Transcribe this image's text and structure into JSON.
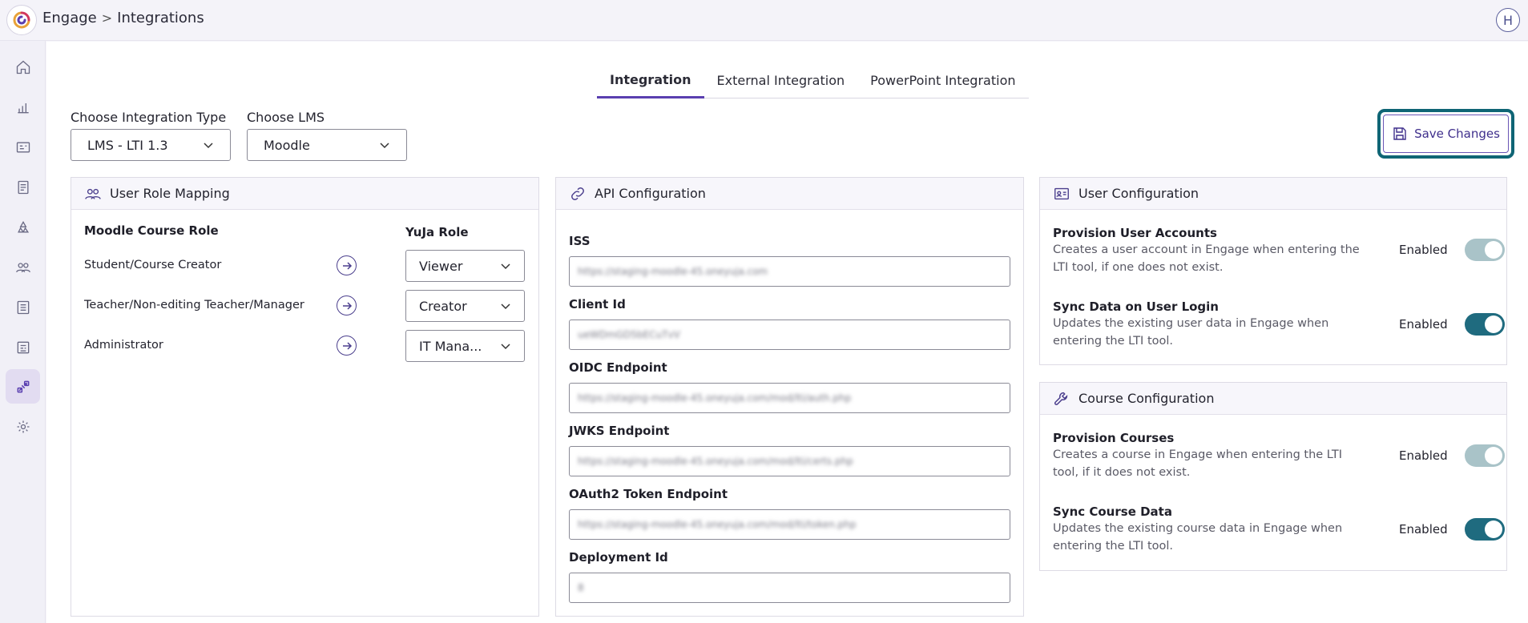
{
  "header": {
    "app_name": "Engage",
    "separator": ">",
    "page": "Integrations",
    "avatar_initial": "H"
  },
  "sidebar": {
    "items": [
      {
        "icon": "home-icon"
      },
      {
        "icon": "bar-chart-icon"
      },
      {
        "icon": "id-card-icon"
      },
      {
        "icon": "document-icon"
      },
      {
        "icon": "recycle-icon"
      },
      {
        "icon": "users-icon"
      },
      {
        "icon": "list-icon"
      },
      {
        "icon": "book-icon"
      },
      {
        "icon": "integrations-icon",
        "active": true
      },
      {
        "icon": "gear-icon"
      }
    ]
  },
  "tabs": [
    {
      "label": "Integration",
      "active": true
    },
    {
      "label": "External Integration"
    },
    {
      "label": "PowerPoint Integration"
    }
  ],
  "integration_type": {
    "label": "Choose Integration Type",
    "value": "LMS - LTI 1.3"
  },
  "lms": {
    "label": "Choose LMS",
    "value": "Moodle"
  },
  "save_button": {
    "label": "Save Changes"
  },
  "role_mapping": {
    "title": "User Role Mapping",
    "lms_role_header": "Moodle Course Role",
    "yuja_role_header": "YuJa Role",
    "rows": [
      {
        "lms_role": "Student/Course Creator",
        "yuja_role": "Viewer"
      },
      {
        "lms_role": "Teacher/Non-editing Teacher/Manager",
        "yuja_role": "Creator"
      },
      {
        "lms_role": "Administrator",
        "yuja_role": "IT Mana..."
      }
    ]
  },
  "api_config": {
    "title": "API Configuration",
    "fields": [
      {
        "label": "ISS",
        "value": "https://staging-moodle-45.oneyuja.com"
      },
      {
        "label": "Client Id",
        "value": "ueWDmGD5bECuTvV"
      },
      {
        "label": "OIDC Endpoint",
        "value": "https://staging-moodle-45.oneyuja.com/mod/lti/auth.php"
      },
      {
        "label": "JWKS Endpoint",
        "value": "https://staging-moodle-45.oneyuja.com/mod/lti/certs.php"
      },
      {
        "label": "OAuth2 Token Endpoint",
        "value": "https://staging-moodle-45.oneyuja.com/mod/lti/token.php"
      },
      {
        "label": "Deployment Id",
        "value": "8"
      }
    ]
  },
  "user_config": {
    "title": "User Configuration",
    "items": [
      {
        "title": "Provision User Accounts",
        "desc": "Creates a user account in Engage when entering the LTI tool, if one does not exist.",
        "status": "Enabled",
        "toggle_state": "on-disabled"
      },
      {
        "title": "Sync Data on User Login",
        "desc": "Updates the existing user data in Engage when entering the LTI tool.",
        "status": "Enabled",
        "toggle_state": "on"
      }
    ]
  },
  "course_config": {
    "title": "Course Configuration",
    "items": [
      {
        "title": "Provision Courses",
        "desc": "Creates a course in Engage when entering the LTI tool, if it does not exist.",
        "status": "Enabled",
        "toggle_state": "on-disabled"
      },
      {
        "title": "Sync Course Data",
        "desc": "Updates the existing course data in Engage when entering the LTI tool.",
        "status": "Enabled",
        "toggle_state": "on"
      }
    ]
  },
  "colors": {
    "accent": "#5a3fb0",
    "toggle_on": "#1f6b7f",
    "toggle_disabled": "#a9c3c8",
    "save_focus_ring": "#0f6575"
  }
}
